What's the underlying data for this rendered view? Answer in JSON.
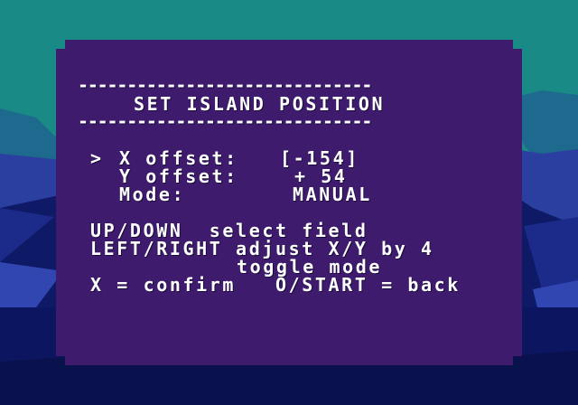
{
  "menu": {
    "rule": "------------------------------",
    "title": "SET ISLAND POSITION",
    "cursor": ">",
    "fields": [
      {
        "label": "X offset:",
        "value": "[-154]",
        "selected": true
      },
      {
        "label": "Y offset:",
        "value": "+ 54",
        "selected": false
      },
      {
        "label": "Mode:",
        "value": "MANUAL",
        "selected": false
      }
    ],
    "help": [
      "UP/DOWN  select field",
      "LEFT/RIGHT adjust X/Y by 4",
      "toggle mode",
      "X = confirm   O/START = back"
    ]
  },
  "colors": {
    "panel": "#3e1b6d",
    "text": "#ffffff",
    "sky": "#1a8a86",
    "sea": "#101c6a"
  }
}
